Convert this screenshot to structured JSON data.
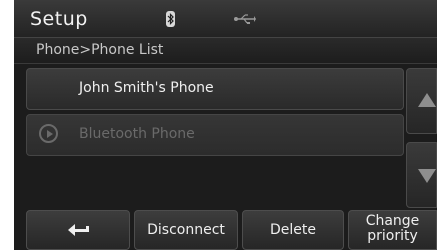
{
  "header": {
    "title": "Setup",
    "status_icons": [
      "bluetooth-icon",
      "usb-icon"
    ]
  },
  "breadcrumb": "Phone>Phone List",
  "phone_list": {
    "items": [
      {
        "label": "John Smith's Phone",
        "state": "active"
      },
      {
        "label": "Bluetooth Phone",
        "state": "disabled",
        "icon": "play-icon"
      }
    ]
  },
  "scroll": {
    "up_icon": "arrow-up-icon",
    "down_icon": "arrow-down-icon"
  },
  "bottom_bar": {
    "back_icon": "back-icon",
    "disconnect_label": "Disconnect",
    "delete_label": "Delete",
    "priority_label_line1": "Change",
    "priority_label_line2": "priority"
  },
  "colors": {
    "background": "#1c1c1c",
    "text": "#f0f0f0",
    "disabled_text": "#6a6a6a"
  }
}
